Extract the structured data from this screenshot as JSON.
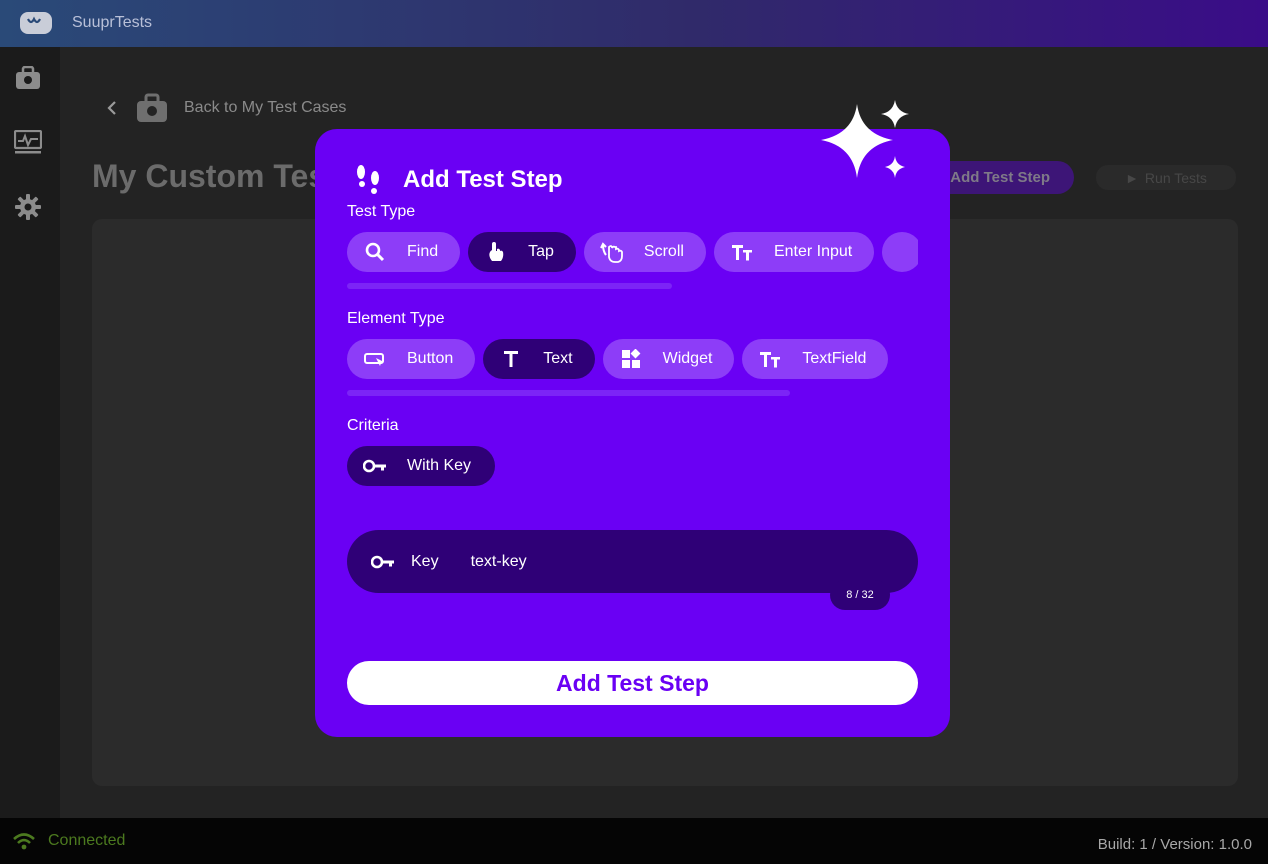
{
  "app": {
    "title": "SuuprTests"
  },
  "sidebar": {
    "items": [
      {
        "icon": "briefcase-icon"
      },
      {
        "icon": "monitor-heartbeat-icon"
      },
      {
        "icon": "gear-icon"
      }
    ]
  },
  "page": {
    "back_label": "Back to My Test Cases",
    "title": "My Custom Test",
    "add_step_label": "Add Test Step",
    "run_label": "Run Tests"
  },
  "dialog": {
    "title": "Add Test Step",
    "test_type": {
      "label": "Test Type",
      "options": [
        {
          "label": "Find",
          "icon": "search-icon",
          "selected": false
        },
        {
          "label": "Tap",
          "icon": "tap-hand-icon",
          "selected": true
        },
        {
          "label": "Scroll",
          "icon": "scroll-hand-icon",
          "selected": false
        },
        {
          "label": "Enter Input",
          "icon": "text-size-icon",
          "selected": false
        }
      ]
    },
    "element_type": {
      "label": "Element Type",
      "options": [
        {
          "label": "Button",
          "icon": "button-cursor-icon",
          "selected": false
        },
        {
          "label": "Text",
          "icon": "text-t-icon",
          "selected": true
        },
        {
          "label": "Widget",
          "icon": "widgets-icon",
          "selected": false
        },
        {
          "label": "TextField",
          "icon": "text-size-icon",
          "selected": false
        }
      ]
    },
    "criteria": {
      "label": "Criteria",
      "options": [
        {
          "label": "With Key",
          "icon": "key-icon",
          "selected": true
        }
      ]
    },
    "key_field": {
      "label": "Key",
      "value": "text-key",
      "counter": "8 / 32"
    },
    "submit_label": "Add Test Step"
  },
  "status": {
    "connection": "Connected",
    "build": "Build: 1 / Version: 1.0.0"
  },
  "colors": {
    "accent": "#6a00f4",
    "chip": "#8d3df8",
    "chip_selected": "#2f0077",
    "connected": "#4c7a1f"
  }
}
